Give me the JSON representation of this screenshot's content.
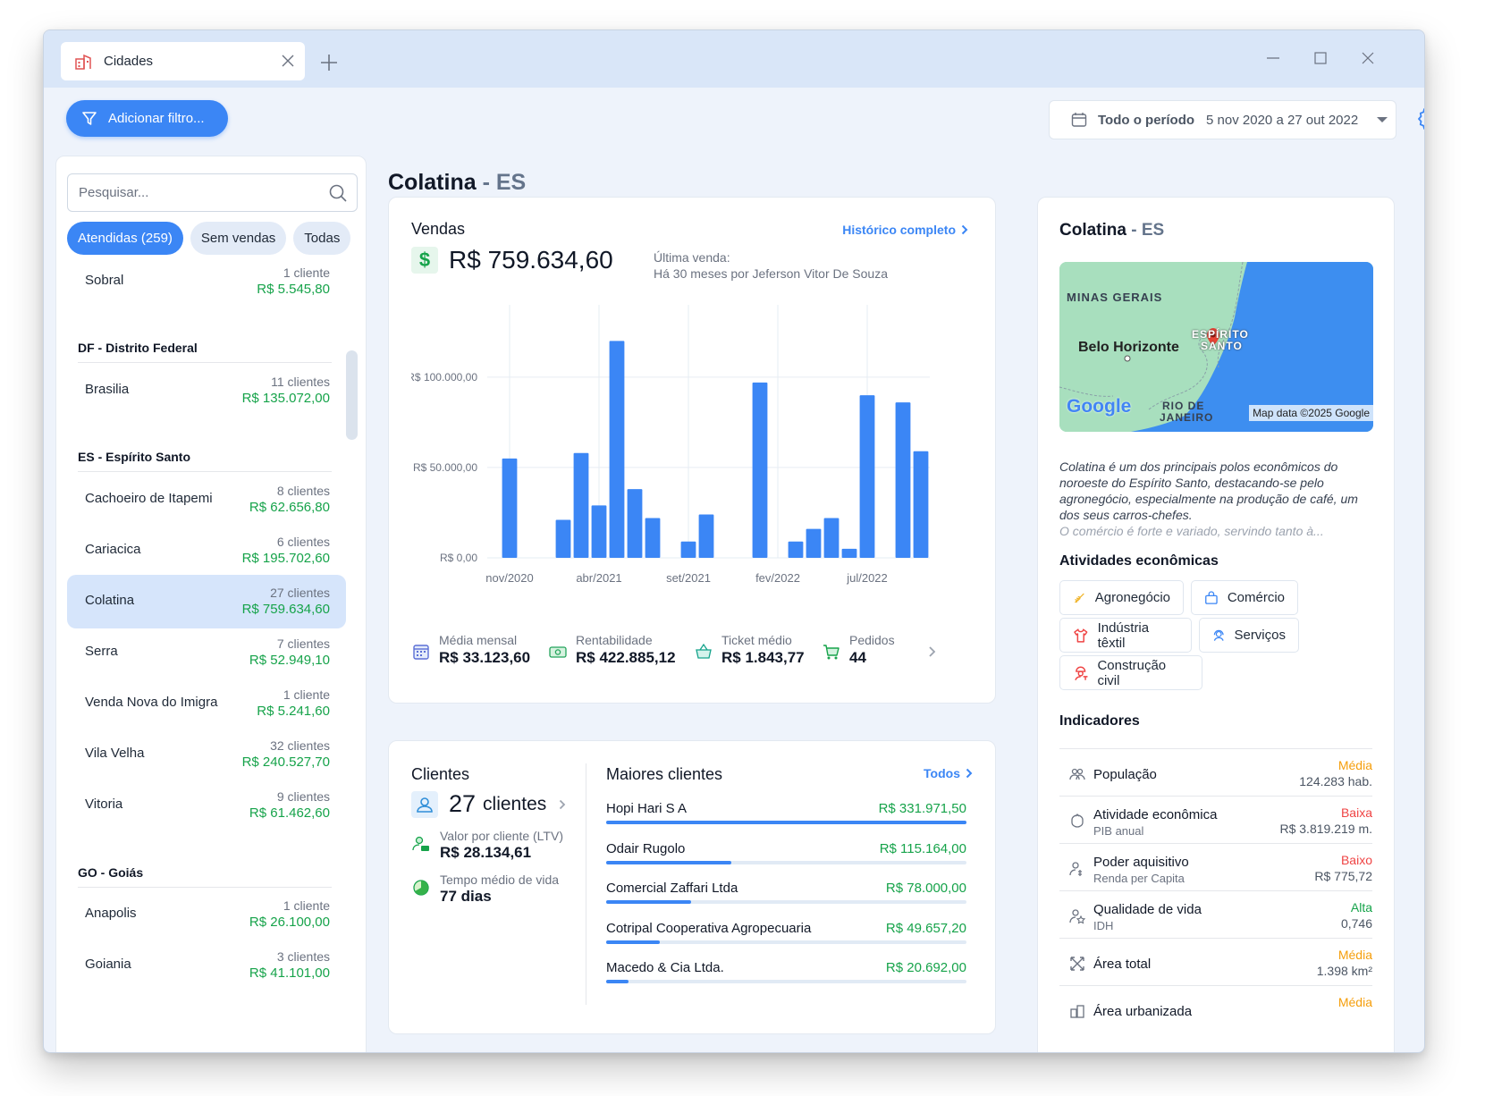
{
  "tab": {
    "label": "Cidades"
  },
  "toolbar": {
    "filter_label": "Adicionar filtro...",
    "period_label": "Todo o período",
    "period_value": "5 nov 2020 a 27 out 2022"
  },
  "sidebar": {
    "search_placeholder": "Pesquisar...",
    "chips": [
      "Atendidas (259)",
      "Sem vendas",
      "Todas"
    ],
    "groups": [
      "DF - Distrito Federal",
      "ES - Espírito Santo",
      "GO - Goiás"
    ],
    "cities": [
      {
        "name": "Sobral",
        "count": "1 cliente",
        "value": "R$ 5.545,80"
      },
      {
        "name": "Brasilia",
        "count": "11 clientes",
        "value": "R$ 135.072,00"
      },
      {
        "name": "Cachoeiro de Itapemi",
        "count": "8 clientes",
        "value": "R$ 62.656,80"
      },
      {
        "name": "Cariacica",
        "count": "6 clientes",
        "value": "R$ 195.702,60"
      },
      {
        "name": "Colatina",
        "count": "27 clientes",
        "value": "R$ 759.634,60"
      },
      {
        "name": "Serra",
        "count": "7 clientes",
        "value": "R$ 52.949,10"
      },
      {
        "name": "Venda Nova do Imigra",
        "count": "1 cliente",
        "value": "R$ 5.241,60"
      },
      {
        "name": "Vila Velha",
        "count": "32 clientes",
        "value": "R$ 240.527,70"
      },
      {
        "name": "Vitoria",
        "count": "9 clientes",
        "value": "R$ 61.462,60"
      },
      {
        "name": "Anapolis",
        "count": "1 cliente",
        "value": "R$ 26.100,00"
      },
      {
        "name": "Goiania",
        "count": "3 clientes",
        "value": "R$ 41.101,00"
      }
    ]
  },
  "main": {
    "city": "Colatina",
    "state": "ES",
    "sep": " - "
  },
  "vendas": {
    "title": "Vendas",
    "link": "Histórico completo",
    "total": "R$ 759.634,60",
    "last_label": "Última venda:",
    "last_value": "Há 30 meses por Jeferson Vitor De Souza",
    "metrics": [
      {
        "label": "Média mensal",
        "value": "R$ 33.123,60"
      },
      {
        "label": "Rentabilidade",
        "value": "R$ 422.885,12"
      },
      {
        "label": "Ticket médio",
        "value": "R$ 1.843,77"
      },
      {
        "label": "Pedidos",
        "value": "44"
      }
    ]
  },
  "chart_data": {
    "type": "bar",
    "categories": [
      "nov/2020",
      "dez/2020",
      "jan/2021",
      "fev/2021",
      "mar/2021",
      "abr/2021",
      "mai/2021",
      "jun/2021",
      "jul/2021",
      "ago/2021",
      "set/2021",
      "out/2021",
      "nov/2021",
      "dez/2021",
      "jan/2022",
      "fev/2022",
      "mar/2022",
      "abr/2022",
      "mai/2022",
      "jun/2022",
      "jul/2022",
      "ago/2022",
      "set/2022",
      "out/2022"
    ],
    "values": [
      55000,
      0,
      0,
      21000,
      58000,
      29000,
      120000,
      38000,
      22000,
      0,
      9000,
      24000,
      0,
      0,
      97000,
      0,
      9000,
      16000,
      22000,
      5000,
      90000,
      0,
      86000,
      59000
    ],
    "tick_labels": [
      "nov/2020",
      "abr/2021",
      "set/2021",
      "fev/2022",
      "jul/2022"
    ],
    "y_ticks": [
      "R$ 0,00",
      "R$ 50.000,00",
      "R$ 100.000,00"
    ],
    "ylim": [
      0,
      140000
    ],
    "grid": true,
    "color": "#3b86f5"
  },
  "clientes": {
    "title": "Clientes",
    "count": "27",
    "unit": "clientes",
    "ltv_label": "Valor por cliente (LTV)",
    "ltv_value": "R$ 28.134,61",
    "life_label": "Tempo médio de vida",
    "life_value": "77 dias",
    "top_title": "Maiores clientes",
    "top_link": "Todos",
    "top": [
      {
        "name": "Hopi Hari S A",
        "value": "R$ 331.971,50",
        "share": 1.0
      },
      {
        "name": "Odair Rugolo",
        "value": "R$ 115.164,00",
        "share": 0.347
      },
      {
        "name": "Comercial Zaffari Ltda",
        "value": "R$ 78.000,00",
        "share": 0.235
      },
      {
        "name": "Cotripal  Cooperativa Agropecuaria",
        "value": "R$ 49.657,20",
        "share": 0.15
      },
      {
        "name": "Macedo & Cia Ltda.",
        "value": "R$ 20.692,00",
        "share": 0.062
      }
    ]
  },
  "info": {
    "map": {
      "l1": "MINAS GERAIS",
      "l2": "Belo Horizonte",
      "l3": "ESPÍRITO",
      "l4": "SANTO",
      "l5": "RIO DE",
      "l6": "JANEIRO",
      "logo": "Google",
      "attr": "Map data ©2025 Google"
    },
    "desc1": "Colatina é um dos principais polos econômicos do noroeste do Espírito Santo, destacando-se pelo agronegócio, especialmente na produção de café, um dos seus carros-chefes.",
    "desc2": "O comércio é forte e variado, servindo tanto à...",
    "activities_title": "Atividades econômicas",
    "activities": [
      "Agronegócio",
      "Comércio",
      "Indústria têxtil",
      "Serviços",
      "Construção civil"
    ],
    "indicators_title": "Indicadores",
    "indicators": [
      {
        "name": "População",
        "sub": "",
        "level": "Média",
        "value": "124.283 hab."
      },
      {
        "name": "Atividade econômica",
        "sub": "PIB anual",
        "level": "Baixa",
        "value": "R$ 3.819.219 m."
      },
      {
        "name": "Poder aquisitivo",
        "sub": "Renda per Capita",
        "level": "Baixo",
        "value": "R$ 775,72"
      },
      {
        "name": "Qualidade de vida",
        "sub": "IDH",
        "level": "Alta",
        "value": "0,746"
      },
      {
        "name": "Área total",
        "sub": "",
        "level": "Média",
        "value": "1.398 km²"
      },
      {
        "name": "Área urbanizada",
        "sub": "",
        "level": "Média",
        "value": ""
      }
    ]
  },
  "colors": {
    "accent": "#3b86f5",
    "positive": "#16a34a",
    "medium": "#f59e0b",
    "low": "#ef4444"
  }
}
